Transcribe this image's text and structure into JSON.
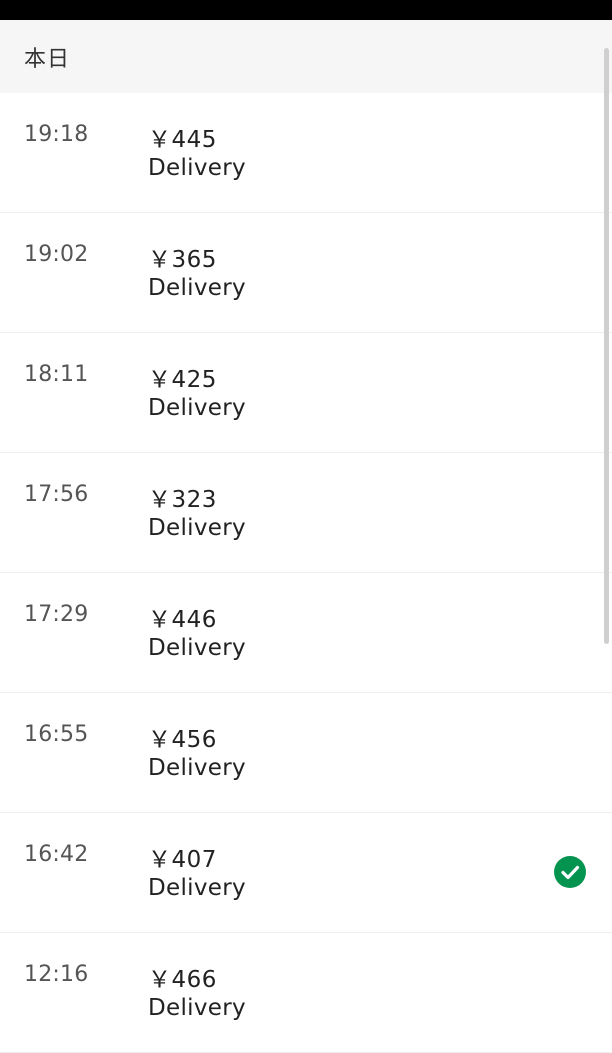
{
  "section": {
    "title": "本日"
  },
  "trips": [
    {
      "time": "19:18",
      "amount": "￥445",
      "type": "Delivery",
      "selected": false
    },
    {
      "time": "19:02",
      "amount": "￥365",
      "type": "Delivery",
      "selected": false
    },
    {
      "time": "18:11",
      "amount": "￥425",
      "type": "Delivery",
      "selected": false
    },
    {
      "time": "17:56",
      "amount": "￥323",
      "type": "Delivery",
      "selected": false
    },
    {
      "time": "17:29",
      "amount": "￥446",
      "type": "Delivery",
      "selected": false
    },
    {
      "time": "16:55",
      "amount": "￥456",
      "type": "Delivery",
      "selected": false
    },
    {
      "time": "16:42",
      "amount": "￥407",
      "type": "Delivery",
      "selected": true
    },
    {
      "time": "12:16",
      "amount": "￥466",
      "type": "Delivery",
      "selected": false
    }
  ],
  "icons": {
    "selected_indicator": "checkmark-circle-icon"
  },
  "colors": {
    "check_green": "#05944f",
    "header_bg": "#f6f6f6",
    "status_bar": "#000000"
  }
}
